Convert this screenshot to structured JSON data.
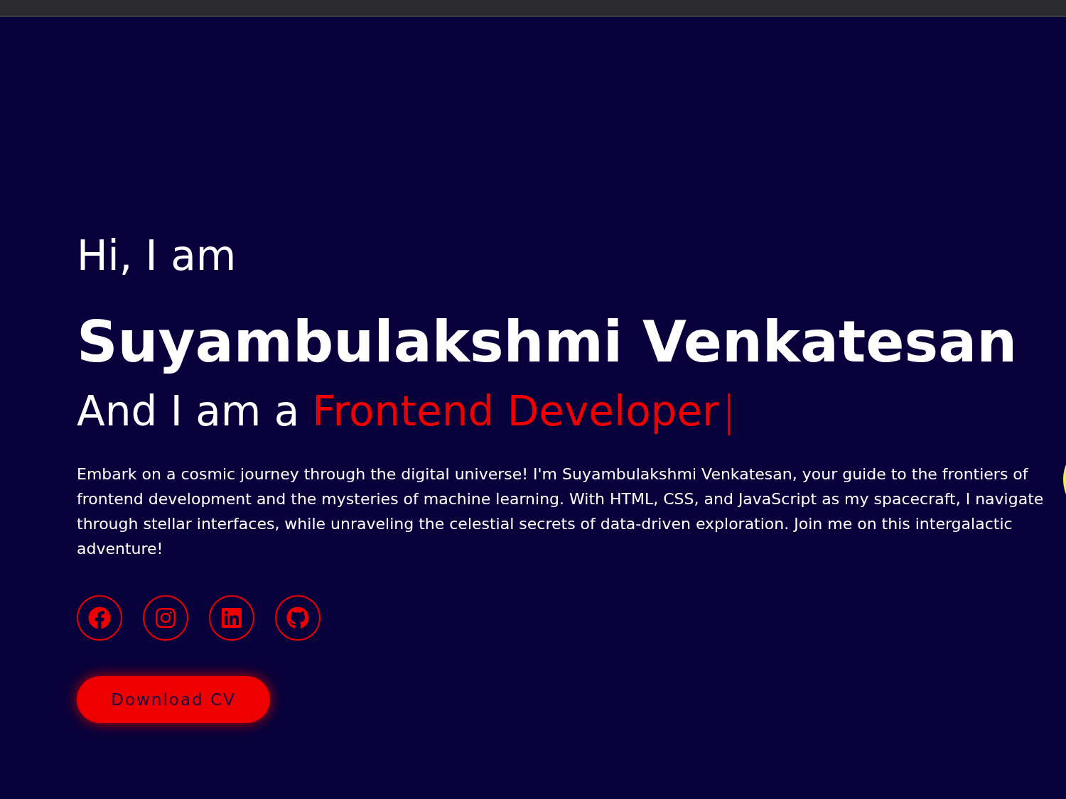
{
  "hero": {
    "greeting": "Hi, I am",
    "name": "Suyambulakshmi Venkatesan",
    "role_prefix": "And I am a",
    "role": "Frontend Developer",
    "cursor": "|",
    "intro": "Embark on a cosmic journey through the digital universe! I'm Suyambulakshmi Venkatesan, your guide to the frontiers of frontend development and the mysteries of machine learning. With HTML, CSS, and JavaScript as my spacecraft, I navigate through stellar interfaces, while unraveling the celestial secrets of data-driven exploration. Join me on this intergalactic adventure!",
    "social_links": [
      {
        "kind": "facebook"
      },
      {
        "kind": "instagram"
      },
      {
        "kind": "linkedin"
      },
      {
        "kind": "github"
      }
    ],
    "button": "Download CV"
  }
}
